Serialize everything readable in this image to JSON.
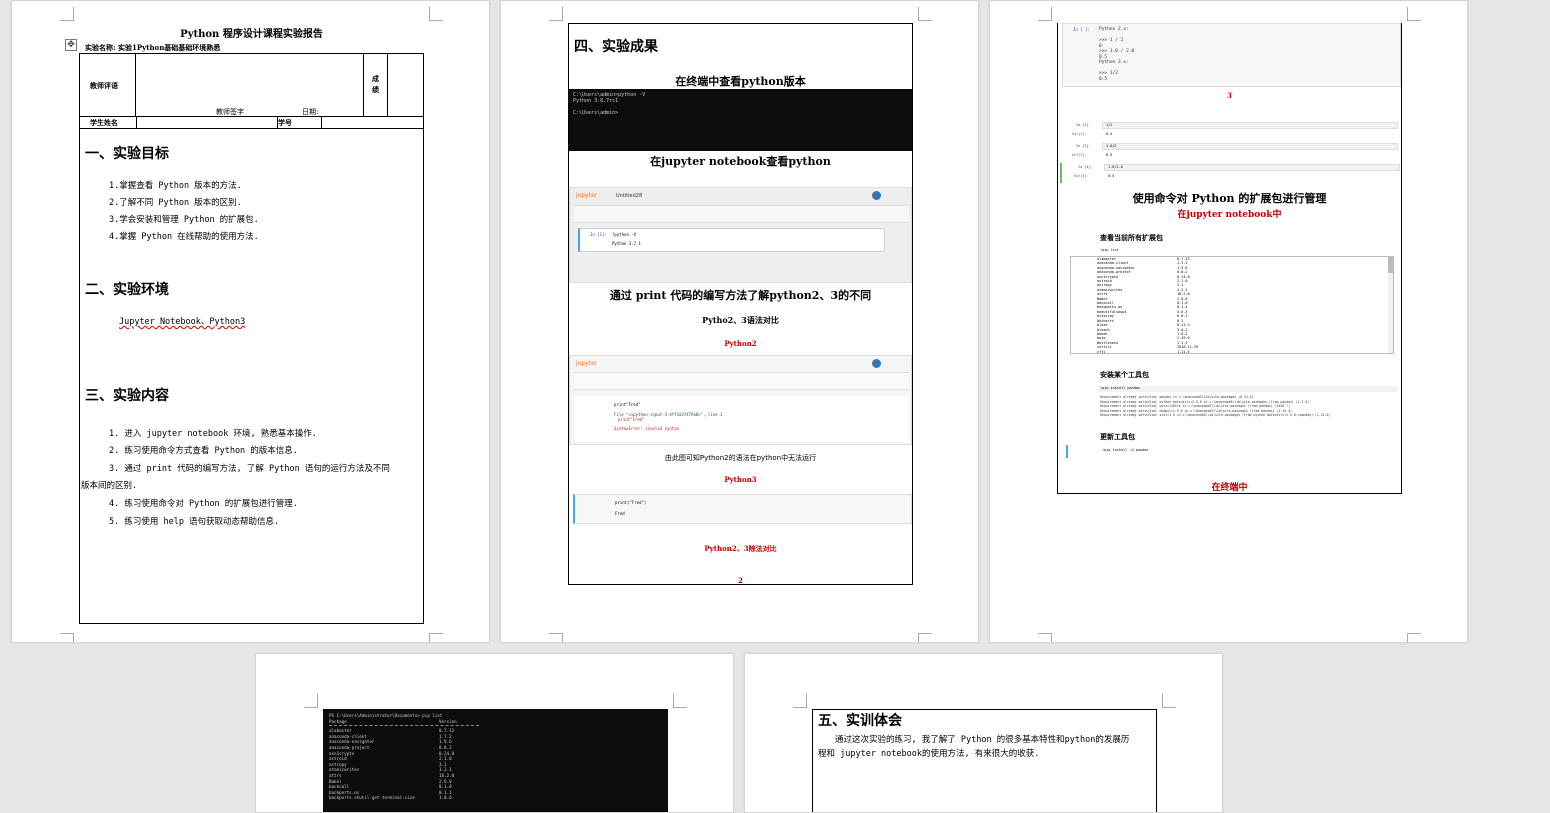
{
  "page1": {
    "title": "Python 程序设计课程实验报告",
    "experiment_name": "实验名称: 实验1Python基础基础环境熟悉",
    "teacher_comment_label": "教师评语",
    "score_label": "成绩",
    "teacher_sign_label": "教师签字",
    "date_label": "日期:",
    "student_name_label": "学生姓名",
    "student_id_label": "学号",
    "section1_title": "一、实验目标",
    "goals": [
      "1.掌握查看 Python 版本的方法.",
      "2.了解不同 Python 版本的区别.",
      "3.学会安装和管理 Python 的扩展包.",
      "4.掌握 Python 在线帮助的使用方法."
    ],
    "section2_title": "二、实验环境",
    "environment": "Jupyter Notebook、Python3",
    "section3_title": "三、实验内容",
    "contents": [
      "1. 进入 jupyter notebook 环境, 熟悉基本操作.",
      "2. 练习使用命令方式查看 Python 的版本信息.",
      "3. 通过 print 代码的编写方法, 了解 Python 语句的运行方法及不同",
      "版本间的区别.",
      "4. 练习使用命令对 Python 的扩展包进行管理.",
      "5. 练习使用 help 语句获取动态帮助信息."
    ]
  },
  "page2": {
    "section4_title": "四、实验成果",
    "caption_terminal": "在终端中查看python版本",
    "terminal_lines": [
      "C:\\Users\\admin>python -V",
      "Python 3.8.7rc1",
      "",
      "C:\\Users\\admin>"
    ],
    "caption_jupyter": "在jupyter notebook查看python",
    "jupyter_title": "jupyter",
    "jupyter_notebook_name": "Untitled28",
    "jupyter_cell_prompt": "In [1]:",
    "jupyter_cell_code": "!python -V",
    "jupyter_cell_output": "Python 3.7.1",
    "caption_print": "通过 print 代码的编写方法了解python2、3的不同",
    "caption_compare": "Pytho2、3语法对比",
    "label_python2": "Python2",
    "py2_code": "print\"Fred\"",
    "py2_error1": "File \"<ipython-input-3-4ff3a3f479a0>\", line 1",
    "py2_error2": "print\"Fred\"",
    "py2_error3": "SyntaxError: invalid syntax",
    "caption_py2_fail": "由此图可知Python2的语法在python中无法运行",
    "label_python3": "Python3",
    "py3_code": "print(\"Fred\")",
    "py3_output": "Fred",
    "caption_py_div": "Python2、3除法对比",
    "page_number": "2"
  },
  "page3": {
    "code_lines": [
      "Python 2.x:",
      "",
      ">>> 1 / 2",
      "0",
      ">>> 1.0 / 2.0",
      "0.5",
      "Python 3.x:",
      "",
      ">>> 1/2",
      "0.5"
    ],
    "number": "3",
    "cell_rows": [
      {
        "prompt": "In [2]:",
        "code": "1/2",
        "out": "Out[2]:",
        "val": "0.5"
      },
      {
        "prompt": "In [3]:",
        "code": "1.0/2",
        "out": "Out[3]:",
        "val": "0.5"
      },
      {
        "prompt": "In [4]:",
        "code": "1.0/2.0",
        "out": "Out[4]:",
        "val": "0.5"
      }
    ],
    "caption_manage": "使用命令对 Python 的扩展包进行管理",
    "caption_in_jupyter": "在jupyter notebook中",
    "caption_view_all": "查看当前所有扩展包",
    "pip_list_cmd": "!pip list",
    "packages": [
      [
        "alabaster",
        "0.7.12"
      ],
      [
        "anaconda-client",
        "1.7.2"
      ],
      [
        "anaconda-navigator",
        "1.9.6"
      ],
      [
        "anaconda-project",
        "0.8.2"
      ],
      [
        "asn1crypto",
        "0.24.0"
      ],
      [
        "astroid",
        "2.1.0"
      ],
      [
        "astropy",
        "3.1"
      ],
      [
        "atomicwrites",
        "1.2.1"
      ],
      [
        "attrs",
        "18.2.0"
      ],
      [
        "Babel",
        "2.6.0"
      ],
      [
        "backcall",
        "0.1.0"
      ],
      [
        "backports.os",
        "0.1.1"
      ],
      [
        "beautifulsoup4",
        "4.6.3"
      ],
      [
        "bitarray",
        "0.8.3"
      ],
      [
        "bkcharts",
        "0.2"
      ],
      [
        "blaze",
        "0.11.3"
      ],
      [
        "bleach",
        "3.0.2"
      ],
      [
        "bokeh",
        "1.0.2"
      ],
      [
        "boto",
        "2.49.0"
      ],
      [
        "Bottleneck",
        "1.2.1"
      ],
      [
        "certifi",
        "2018.11.29"
      ],
      [
        "cffi",
        "1.11.5"
      ]
    ],
    "caption_install": "安装某个工具包",
    "pip_install_cmd": "!pip install pandas",
    "install_lines": [
      "Requirement already satisfied: pandas in c:\\anaconda3\\lib\\site-packages (0.23.4)",
      "Requirement already satisfied: python-dateutil>=2.5.0 in c:\\anaconda3\\lib\\site-packages (from pandas) (2.7.5)",
      "Requirement already satisfied: pytz>=2011k in c:\\anaconda3\\lib\\site-packages (from pandas) (2018.7)",
      "Requirement already satisfied: numpy>=1.9.0 in c:\\anaconda3\\lib\\site-packages (from pandas) (1.15.4)",
      "Requirement already satisfied: six>=1.5 in c:\\anaconda3\\lib\\site-packages (from python-dateutil>=2.5.0->pandas) (1.12.0)"
    ],
    "caption_update": "更新工具包",
    "pip_update_cmd": "!pip install -U pandas",
    "caption_terminal": "在终端中"
  },
  "page4": {
    "terminal_header": "PS C:\\Users\\Administrator\\Documents> pip list",
    "col_package": "Package",
    "col_version": "Version",
    "packages": [
      [
        "alabaster",
        "0.7.12"
      ],
      [
        "anaconda-client",
        "1.7.2"
      ],
      [
        "anaconda-navigator",
        "1.9.6"
      ],
      [
        "anaconda-project",
        "0.8.2"
      ],
      [
        "asn1crypto",
        "0.24.0"
      ],
      [
        "astroid",
        "2.1.0"
      ],
      [
        "astropy",
        "3.1"
      ],
      [
        "atomicwrites",
        "1.2.1"
      ],
      [
        "attrs",
        "18.2.0"
      ],
      [
        "Babel",
        "2.6.0"
      ],
      [
        "backcall",
        "0.1.0"
      ],
      [
        "backports.os",
        "0.1.1"
      ],
      [
        "backports.shutil-get-terminal-size",
        "1.0.0"
      ]
    ]
  },
  "page5": {
    "section5_title": "五、实训体会",
    "reflection_line1": "通过这次实验的练习, 我了解了 Python 的很多基本特性和python的发展历",
    "reflection_line2": "程和 jupyter notebook的使用方法, 有来很大的收获."
  }
}
